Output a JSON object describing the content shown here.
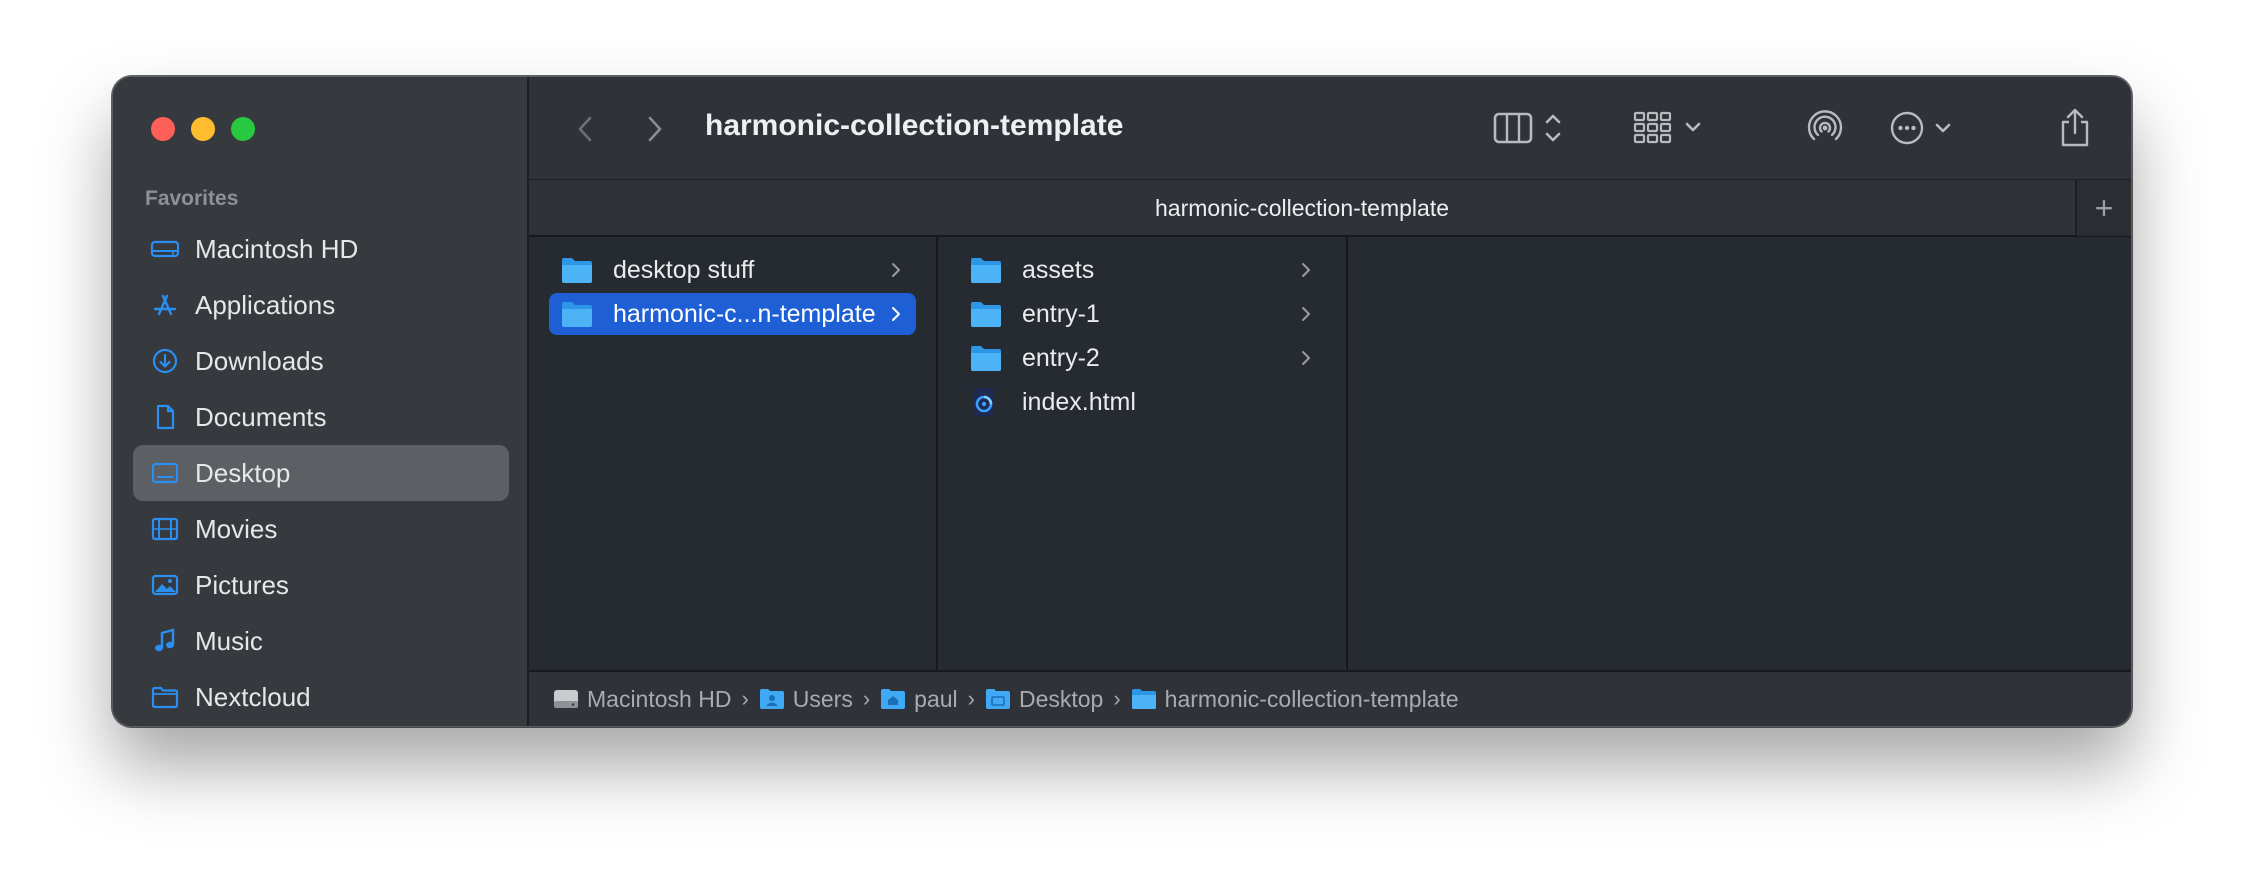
{
  "sidebar": {
    "section_title": "Favorites",
    "items": [
      {
        "label": "Macintosh HD",
        "icon": "drive-icon"
      },
      {
        "label": "Applications",
        "icon": "applications-icon"
      },
      {
        "label": "Downloads",
        "icon": "download-icon"
      },
      {
        "label": "Documents",
        "icon": "document-icon"
      },
      {
        "label": "Desktop",
        "icon": "desktop-icon",
        "selected": true
      },
      {
        "label": "Movies",
        "icon": "film-icon"
      },
      {
        "label": "Pictures",
        "icon": "photo-icon"
      },
      {
        "label": "Music",
        "icon": "music-icon"
      },
      {
        "label": "Nextcloud",
        "icon": "folder-icon"
      }
    ]
  },
  "toolbar": {
    "title": "harmonic-collection-template"
  },
  "tab": {
    "label": "harmonic-collection-template",
    "add": "+"
  },
  "columns": {
    "col1": [
      {
        "label": "desktop stuff",
        "type": "folder"
      },
      {
        "label": "harmonic-c...n-template",
        "type": "folder",
        "selected": true
      }
    ],
    "col2": [
      {
        "label": "assets",
        "type": "folder"
      },
      {
        "label": "entry-1",
        "type": "folder"
      },
      {
        "label": "entry-2",
        "type": "folder"
      },
      {
        "label": "index.html",
        "type": "html-file"
      }
    ]
  },
  "pathbar": [
    {
      "label": "Macintosh HD",
      "icon": "drive-icon"
    },
    {
      "label": "Users",
      "icon": "users-folder-icon"
    },
    {
      "label": "paul",
      "icon": "home-folder-icon"
    },
    {
      "label": "Desktop",
      "icon": "desktop-folder-icon"
    },
    {
      "label": "harmonic-collection-template",
      "icon": "folder-icon"
    }
  ],
  "colors": {
    "accent": "#2a8ff0",
    "selection": "#1f5fd6",
    "folder": "#3fa9f5"
  }
}
